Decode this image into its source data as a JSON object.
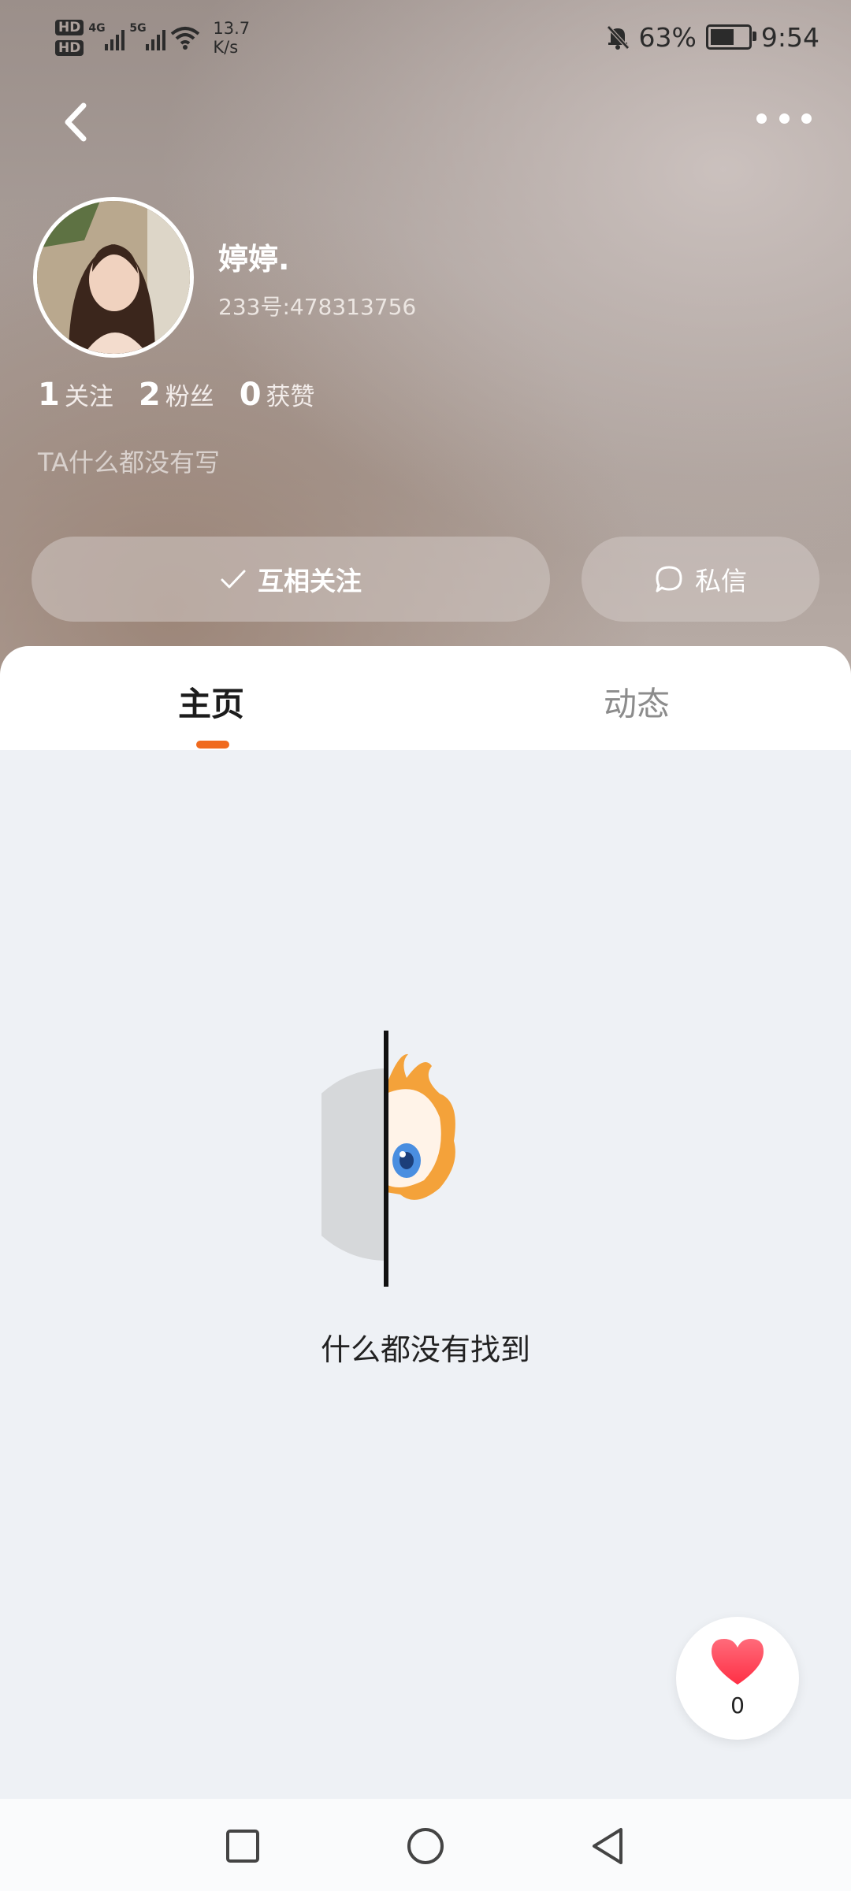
{
  "status_bar": {
    "hd1": "HD",
    "hd2": "HD",
    "net1": "4G",
    "net2": "5G",
    "speed_value": "13.7",
    "speed_unit": "K/s",
    "battery_percent": "63%",
    "battery_level": 0.63,
    "time": "9:54"
  },
  "profile": {
    "name": "婷婷.",
    "id_text": "233号:478313756",
    "stats": [
      {
        "count": "1",
        "label": "关注"
      },
      {
        "count": "2",
        "label": "粉丝"
      },
      {
        "count": "0",
        "label": "获赞"
      }
    ],
    "bio": "TA什么都没有写"
  },
  "actions": {
    "follow_label": "互相关注",
    "message_label": "私信"
  },
  "tabs": [
    {
      "label": "主页",
      "active": true
    },
    {
      "label": "动态",
      "active": false
    }
  ],
  "empty_state": {
    "text": "什么都没有找到"
  },
  "like_widget": {
    "count": "0"
  },
  "colors": {
    "accent": "#f06a1e",
    "heart": "#ff3b4e",
    "page_bg": "#eef1f5"
  },
  "icons": [
    "back-arrow-icon",
    "more-dots-icon",
    "check-icon",
    "chat-bubble-icon",
    "heart-icon",
    "square-icon",
    "circle-icon",
    "triangle-back-icon"
  ]
}
